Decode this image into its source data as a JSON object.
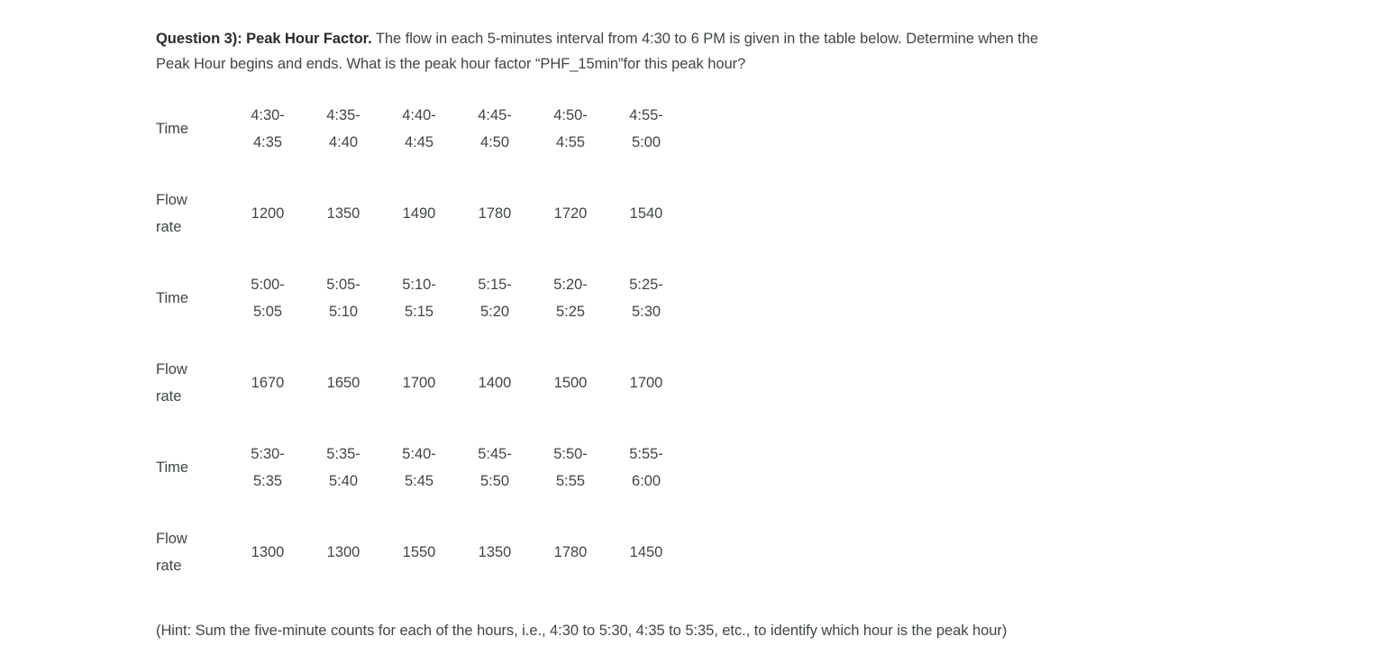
{
  "question": {
    "lead": "Question 3): Peak Hour Factor.",
    "body": " The flow in each 5-minutes interval from 4:30 to 6 PM is given in the table below. Determine when the Peak Hour begins and ends. What is the peak hour factor “PHF_15min”for this peak hour?"
  },
  "table": {
    "time_label": "Time",
    "flow_label_line1": "Flow",
    "flow_label_line2": "rate",
    "blocks": [
      {
        "times": [
          {
            "start": "4:30-",
            "end": "4:35"
          },
          {
            "start": "4:35-",
            "end": "4:40"
          },
          {
            "start": "4:40-",
            "end": "4:45"
          },
          {
            "start": "4:45-",
            "end": "4:50"
          },
          {
            "start": "4:50-",
            "end": "4:55"
          },
          {
            "start": "4:55-",
            "end": "5:00"
          }
        ],
        "flows": [
          "1200",
          "1350",
          "1490",
          "1780",
          "1720",
          "1540"
        ]
      },
      {
        "times": [
          {
            "start": "5:00-",
            "end": "5:05"
          },
          {
            "start": "5:05-",
            "end": "5:10"
          },
          {
            "start": "5:10-",
            "end": "5:15"
          },
          {
            "start": "5:15-",
            "end": "5:20"
          },
          {
            "start": "5:20-",
            "end": "5:25"
          },
          {
            "start": "5:25-",
            "end": "5:30"
          }
        ],
        "flows": [
          "1670",
          "1650",
          "1700",
          "1400",
          "1500",
          "1700"
        ]
      },
      {
        "times": [
          {
            "start": "5:30-",
            "end": "5:35"
          },
          {
            "start": "5:35-",
            "end": "5:40"
          },
          {
            "start": "5:40-",
            "end": "5:45"
          },
          {
            "start": "5:45-",
            "end": "5:50"
          },
          {
            "start": "5:50-",
            "end": "5:55"
          },
          {
            "start": "5:55-",
            "end": "6:00"
          }
        ],
        "flows": [
          "1300",
          "1300",
          "1550",
          "1350",
          "1780",
          "1450"
        ]
      }
    ]
  },
  "hint": "(Hint: Sum the five-minute counts for each of the hours, i.e., 4:30 to 5:30, 4:35 to 5:35, etc., to identify which hour is the peak hour)",
  "colors": {
    "background": "#ffffff",
    "body_text": "#3f4548",
    "heading_text": "#2b2b2b"
  }
}
